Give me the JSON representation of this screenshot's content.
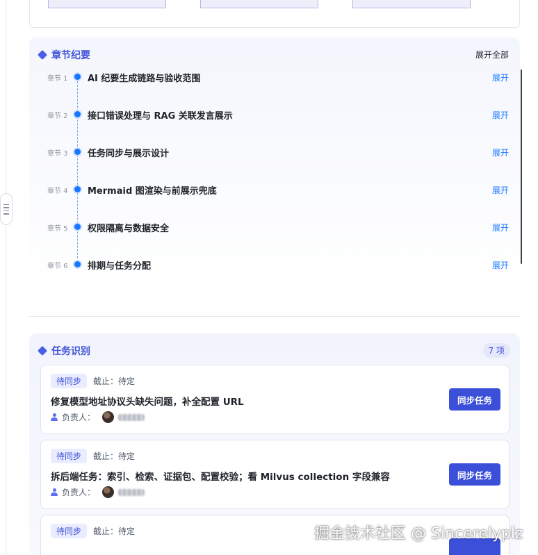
{
  "chapters_section": {
    "title": "章节纪要",
    "expand_all_label": "展开全部",
    "items": [
      {
        "num": "章节 1",
        "title": "AI 纪要生成链路与验收范围",
        "expand": "展开"
      },
      {
        "num": "章节 2",
        "title": "接口错误处理与 RAG 关联发言展示",
        "expand": "展开"
      },
      {
        "num": "章节 3",
        "title": "任务同步与展示设计",
        "expand": "展开"
      },
      {
        "num": "章节 4",
        "title": "Mermaid 图渲染与前展示兜底",
        "expand": "展开"
      },
      {
        "num": "章节 5",
        "title": "权限隔离与数据安全",
        "expand": "展开"
      },
      {
        "num": "章节 6",
        "title": "排期与任务分配",
        "expand": "展开"
      }
    ]
  },
  "tasks_section": {
    "title": "任务识别",
    "count_label": "7 项",
    "tasks": [
      {
        "status": "待同步",
        "deadline": "截止：待定",
        "title": "修复模型地址协议头缺失问题，补全配置 URL",
        "assignee_label": "负责人：",
        "button": "同步任务"
      },
      {
        "status": "待同步",
        "deadline": "截止：待定",
        "title": "拆后端任务：索引、检索、证据包、配置校验；看 Milvus collection 字段兼容",
        "assignee_label": "负责人：",
        "button": "同步任务"
      },
      {
        "status": "待同步",
        "deadline": "截止：待定",
        "title": "",
        "assignee_label": "",
        "button": ""
      }
    ]
  },
  "watermark": "掘金技术社区 @ Sincerelyplz",
  "colors": {
    "accent": "#3f51d6",
    "link": "#1677ff",
    "button": "#3b4fd8"
  }
}
